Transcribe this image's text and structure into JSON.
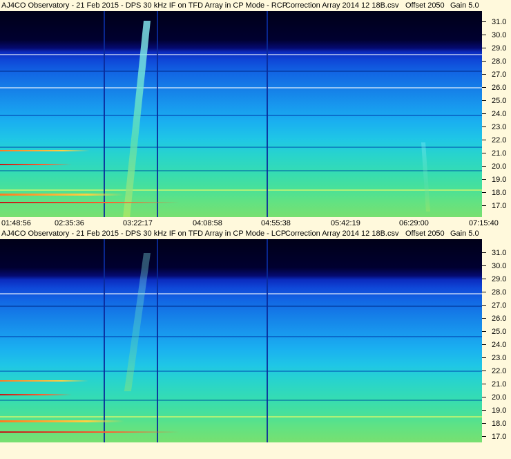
{
  "top": {
    "title": "AJ4CO Observatory - 21 Feb 2015 - DPS 30 kHz IF on TFD Array in CP Mode - RCP",
    "correction": "Correction Array 2014 12 18B.csv",
    "offset": "Offset 2050",
    "gain": "Gain 5.0",
    "freq_labels": [
      "31.0",
      "30.0",
      "29.0",
      "28.0",
      "27.0",
      "26.0",
      "25.0",
      "24.0",
      "23.0",
      "22.0",
      "21.0",
      "20.0",
      "19.0",
      "18.0",
      "17.0"
    ],
    "time_labels": [
      "01:48:56",
      "02:35:36",
      "03:22:17",
      "04:08:58",
      "04:55:38",
      "05:42:19",
      "06:29:00",
      "07:15:40"
    ]
  },
  "bottom": {
    "title": "AJ4CO Observatory - 21 Feb 2015 - DPS 30 kHz IF on TFD Array in CP Mode - LCP",
    "correction": "Correction Array 2014 12 18B.csv",
    "offset": "Offset 2050",
    "gain": "Gain 5.0",
    "freq_labels": [
      "31.0",
      "30.0",
      "29.0",
      "28.0",
      "27.0",
      "26.0",
      "25.0",
      "24.0",
      "23.0",
      "22.0",
      "21.0",
      "20.0",
      "19.0",
      "18.0",
      "17.0"
    ]
  },
  "colors": {
    "background": "#fff9dc",
    "spectrogram_low": "#000018",
    "spectrogram_high": "#78e070",
    "streak": "#ff7a20"
  }
}
